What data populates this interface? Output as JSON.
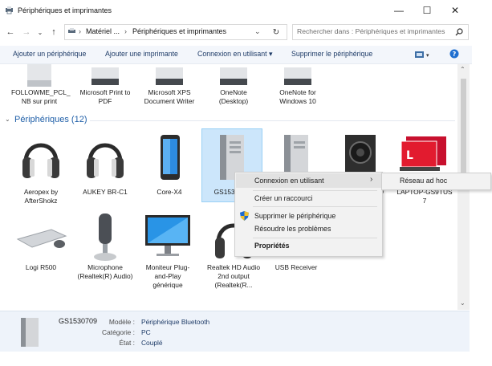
{
  "window": {
    "title": "Périphériques et imprimantes"
  },
  "address": {
    "crumbs": [
      "Matériel ...",
      "Périphériques et imprimantes"
    ],
    "search_placeholder": "Rechercher dans : Périphériques et imprimantes"
  },
  "commands": [
    "Ajouter un périphérique",
    "Ajouter une imprimante",
    "Connexion en utilisant ▾",
    "Supprimer le périphérique"
  ],
  "printers": [
    {
      "label": "FOLLOWME_PCL_ NB sur print"
    },
    {
      "label": "Microsoft Print to PDF"
    },
    {
      "label": "Microsoft XPS Document Writer"
    },
    {
      "label": "OneNote (Desktop)"
    },
    {
      "label": "OneNote for Windows 10"
    }
  ],
  "group": {
    "label": "Périphériques (12)"
  },
  "devices_row1": [
    {
      "label": "Aeropex by AfterShokz",
      "icon": "headphones-icon"
    },
    {
      "label": "AUKEY BR-C1",
      "icon": "headphones-icon"
    },
    {
      "label": "Core-X4",
      "icon": "phone-icon"
    },
    {
      "label": "GS1530709",
      "icon": "computer-tower-icon"
    },
    {
      "label": "",
      "icon": "computer-tower-icon"
    },
    {
      "label": "O",
      "icon": "speaker-icon"
    },
    {
      "label": "LAPTOP-GS9TUS 7",
      "icon": "laptop-icon"
    }
  ],
  "devices_row2": [
    {
      "label": "Logi R500",
      "icon": "keyboard-icon"
    },
    {
      "label": "Microphone (Realtek(R) Audio)",
      "icon": "microphone-icon"
    },
    {
      "label": "Moniteur Plug-and-Play générique",
      "icon": "monitor-icon"
    },
    {
      "label": "Realtek HD Audio 2nd output (Realtek(R...",
      "icon": "headphones-icon"
    },
    {
      "label": "USB Receiver",
      "icon": "usb-receiver-icon"
    }
  ],
  "context_menu": {
    "items": [
      "Connexion en utilisant",
      "Créer un raccourci",
      "Supprimer le périphérique",
      "Résoudre les problèmes",
      "Propriétés"
    ],
    "submenu": [
      "Réseau ad hoc"
    ]
  },
  "details": {
    "name": "GS1530709",
    "rows": [
      {
        "label": "Modèle :",
        "value": "Périphérique Bluetooth"
      },
      {
        "label": "Catégorie :",
        "value": "PC"
      },
      {
        "label": "État :",
        "value": "Couplé"
      }
    ]
  },
  "colors": {
    "accent": "#1f5fa8",
    "selection": "#cce6fb",
    "command_text": "#1f3c68"
  }
}
